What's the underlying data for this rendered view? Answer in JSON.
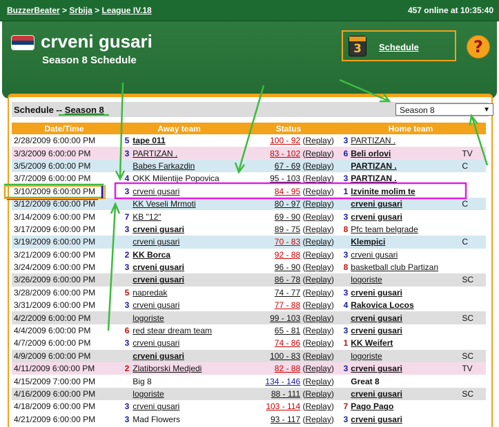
{
  "breadcrumb": {
    "items": [
      "BuzzerBeater",
      "Srbija",
      "League IV.18"
    ],
    "sep": ">"
  },
  "online_status": "457 online at 10:35:40",
  "team": {
    "name": "crveni gusari",
    "season_title": "Season 8 Schedule"
  },
  "schedule_button": {
    "label": "Schedule",
    "icon_number": "3"
  },
  "help_icon": "?",
  "schedule_bar": {
    "label": "Schedule --",
    "season": "Season 8",
    "select_value": "Season 8"
  },
  "columns": [
    "Date/Time",
    "Away team",
    "Status",
    "Home team"
  ],
  "colors": {
    "topbar": "#1e6b32",
    "header": "#2f7a3f",
    "orange": "#f2a21b",
    "annotation_green": "#3dbb3d",
    "annotation_magenta": "#e020e0"
  },
  "rows": [
    {
      "date": "2/28/2009 6:00:00 PM",
      "away_num": "5",
      "away": "tape 011",
      "score": "100 - 92",
      "home_num": "3",
      "home": "PARTIZAN .",
      "extra": ""
    },
    {
      "date": "3/3/2009 6:00:00 PM",
      "away_num": "3",
      "away": "PARTIZAN .",
      "score": "83 - 102",
      "home_num": "6",
      "home": "Beli orlovi",
      "extra": "TV"
    },
    {
      "date": "3/5/2009 6:00:00 PM",
      "away_num": "",
      "away": "Babes Farkazdin",
      "score": "67 - 69",
      "home_num": "",
      "home": "PARTIZAN .",
      "extra": "C"
    },
    {
      "date": "3/7/2009 6:00:00 PM",
      "away_num": "4",
      "away": "OKK Milentije Popovica",
      "score": "95 - 103",
      "home_num": "3",
      "home": "PARTIZAN .",
      "extra": ""
    },
    {
      "date": "3/10/2009 6:00:00 PM",
      "away_num": "3",
      "away": "crveni gusari",
      "score": "84 - 95",
      "home_num": "1",
      "home": "Izvinite molim te",
      "extra": ""
    },
    {
      "date": "3/12/2009 6:00:00 PM",
      "away_num": "",
      "away": "KK Veseli Mrmoti",
      "score": "80 - 97",
      "home_num": "",
      "home": "crveni gusari",
      "extra": "C"
    },
    {
      "date": "3/14/2009 6:00:00 PM",
      "away_num": "7",
      "away": "KB \"12\"",
      "score": "69 - 90",
      "home_num": "3",
      "home": "crveni gusari",
      "extra": ""
    },
    {
      "date": "3/17/2009 6:00:00 PM",
      "away_num": "3",
      "away": "crveni gusari",
      "score": "89 - 75",
      "home_num": "8",
      "home": "Pfc team belgrade",
      "extra": ""
    },
    {
      "date": "3/19/2009 6:00:00 PM",
      "away_num": "",
      "away": "crveni gusari",
      "score": "70 - 83",
      "home_num": "",
      "home": "Klempici",
      "extra": "C"
    },
    {
      "date": "3/21/2009 6:00:00 PM",
      "away_num": "2",
      "away": "KK Borca",
      "score": "92 - 88",
      "home_num": "3",
      "home": "crveni gusari",
      "extra": ""
    },
    {
      "date": "3/24/2009 6:00:00 PM",
      "away_num": "3",
      "away": "crveni gusari",
      "score": "96 - 90",
      "home_num": "8",
      "home": "basketball club Partizan",
      "extra": ""
    },
    {
      "date": "3/26/2009 6:00:00 PM",
      "away_num": "",
      "away": "crveni gusari",
      "score": "86 - 78",
      "home_num": "",
      "home": "logoriste",
      "extra": "SC"
    },
    {
      "date": "3/28/2009 6:00:00 PM",
      "away_num": "5",
      "away": "napredak",
      "score": "74 - 77",
      "home_num": "3",
      "home": "crveni gusari",
      "extra": ""
    },
    {
      "date": "3/31/2009 6:00:00 PM",
      "away_num": "3",
      "away": "crveni gusari",
      "score": "77 - 88",
      "home_num": "4",
      "home": "Rakovica Locos",
      "extra": ""
    },
    {
      "date": "4/2/2009 6:00:00 PM",
      "away_num": "",
      "away": "logoriste",
      "score": "99 - 103",
      "home_num": "",
      "home": "crveni gusari",
      "extra": "SC"
    },
    {
      "date": "4/4/2009 6:00:00 PM",
      "away_num": "6",
      "away": "red stear dream team",
      "score": "65 - 81",
      "home_num": "3",
      "home": "crveni gusari",
      "extra": ""
    },
    {
      "date": "4/7/2009 6:00:00 PM",
      "away_num": "3",
      "away": "crveni gusari",
      "score": "74 - 86",
      "home_num": "1",
      "home": "KK Weifert",
      "extra": ""
    },
    {
      "date": "4/9/2009 6:00:00 PM",
      "away_num": "",
      "away": "crveni gusari",
      "score": "100 - 83",
      "home_num": "",
      "home": "logoriste",
      "extra": "SC"
    },
    {
      "date": "4/11/2009 6:00:00 PM",
      "away_num": "2",
      "away": "Zlatiborski Medjedi",
      "score": "82 - 88",
      "home_num": "3",
      "home": "crveni gusari",
      "extra": "TV"
    },
    {
      "date": "4/15/2009 7:00:00 PM",
      "away_num": "",
      "away": "Big 8",
      "score": "134 - 146",
      "home_num": "",
      "home": "Great 8",
      "extra": ""
    },
    {
      "date": "4/16/2009 6:00:00 PM",
      "away_num": "",
      "away": "logoriste",
      "score": "88 - 111",
      "home_num": "",
      "home": "crveni gusari",
      "extra": "SC"
    },
    {
      "date": "4/18/2009 6:00:00 PM",
      "away_num": "3",
      "away": "crveni gusari",
      "score": "103 - 114",
      "home_num": "7",
      "home": "Pago Pago",
      "extra": ""
    },
    {
      "date": "4/21/2009 6:00:00 PM",
      "away_num": "3",
      "away": "Mad Flowers",
      "score": "93 - 117",
      "home_num": "3",
      "home": "crveni gusari",
      "extra": ""
    }
  ],
  "replay_label": "Replay"
}
